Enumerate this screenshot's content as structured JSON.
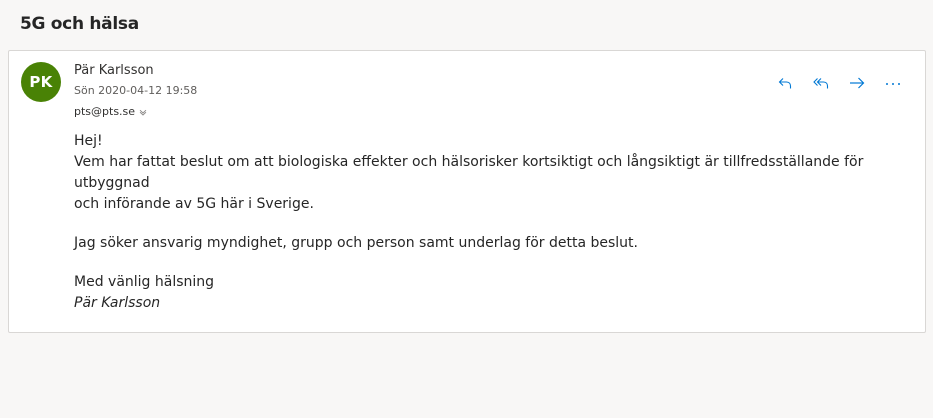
{
  "subject": "5G och hälsa",
  "message": {
    "avatar_initials": "PK",
    "sender_name": "Pär Karlsson",
    "date": "Sön 2020-04-12 19:58",
    "recipient": "pts@pts.se",
    "body": {
      "greeting": "Hej!",
      "line1": "Vem har fattat beslut om att biologiska effekter och hälsorisker kortsiktigt och långsiktigt är tillfredsställande för utbyggnad",
      "line2": "och införande av 5G här i Sverige.",
      "line3": "Jag söker ansvarig myndighet, grupp och person samt underlag för detta beslut.",
      "closing": "Med vänlig hälsning",
      "signature": "Pär Karlsson"
    }
  },
  "colors": {
    "avatar_bg": "#498205",
    "action_icon": "#0078d4"
  },
  "actions": [
    {
      "icon": "reply-icon"
    },
    {
      "icon": "reply-all-icon"
    },
    {
      "icon": "forward-icon"
    },
    {
      "icon": "more-icon"
    }
  ]
}
